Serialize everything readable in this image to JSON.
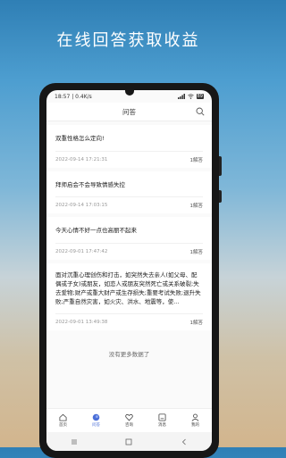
{
  "banner": {
    "title": "在线回答获取收益"
  },
  "status_bar": {
    "time": "18:57",
    "speed": "0.4K/s",
    "battery": "89"
  },
  "header": {
    "title": "问答"
  },
  "questions": [
    {
      "text": "双重性格怎么定向!",
      "date": "2022-09-14 17:21:31",
      "answers": "1解答"
    },
    {
      "text": "拜师启会不会导致情感失控",
      "date": "2022-09-14 17:03:15",
      "answers": "1解答"
    },
    {
      "text": "今天心情不好一点也高丽不起来",
      "date": "2022-09-01 17:47:42",
      "answers": "1解答"
    },
    {
      "text": "面对沉重心理创伤和打击，如突然失去亲人(如父母、配偶或子女)或朋友，如恋人或朋友突然死亡或关系破裂;失去爱物;财产或重大财产或生存损失;重要考试失败;退升失败;严重自然灾害，如火灾、洪水、地震等，使...",
      "date": "2022-09-01 13:49:38",
      "answers": "1解答"
    }
  ],
  "no_more_text": "没有更多数据了",
  "tabs": [
    {
      "label": "首页",
      "icon": "home-icon"
    },
    {
      "label": "问答",
      "icon": "qa-icon",
      "active": true
    },
    {
      "label": "咨询",
      "icon": "heart-icon"
    },
    {
      "label": "消息",
      "icon": "message-icon"
    },
    {
      "label": "我的",
      "icon": "user-icon"
    }
  ],
  "colors": {
    "accent": "#4b6fd8",
    "phone_frame": "#171717"
  }
}
